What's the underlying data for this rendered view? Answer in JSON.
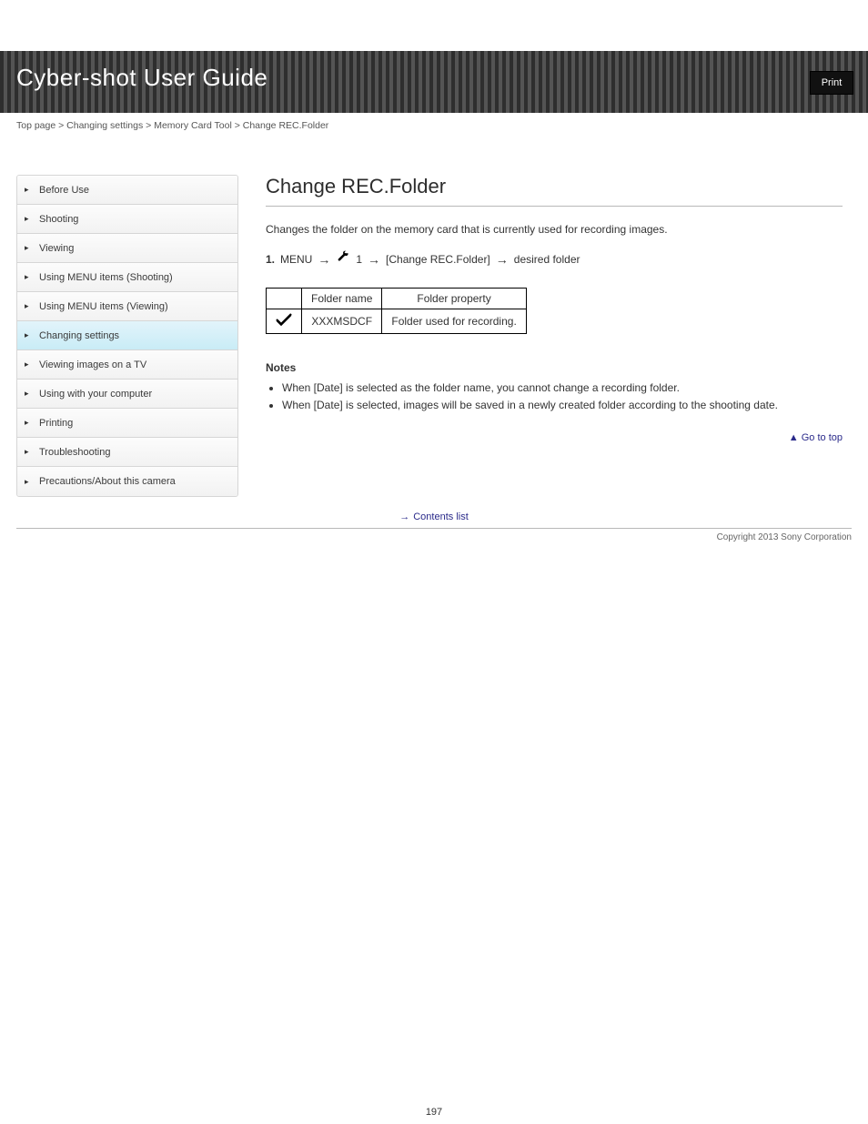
{
  "header": {
    "title": "Cyber-shot User Guide",
    "print_label": "Print"
  },
  "sidebar": {
    "items": [
      {
        "label": "Before Use"
      },
      {
        "label": "Shooting"
      },
      {
        "label": "Viewing"
      },
      {
        "label": "Using MENU items (Shooting)"
      },
      {
        "label": "Using MENU items (Viewing)"
      },
      {
        "label": "Changing settings"
      },
      {
        "label": "Viewing images on a TV"
      },
      {
        "label": "Using with your computer"
      },
      {
        "label": "Printing"
      },
      {
        "label": "Troubleshooting"
      },
      {
        "label": "Precautions/About this camera"
      }
    ]
  },
  "footer_link": {
    "label": "Contents list"
  },
  "breadcrumb": "Top page > Changing settings > Memory Card Tool > Change REC.Folder",
  "content": {
    "title": "Change REC.Folder",
    "description": "Changes the folder on the memory card that is currently used for recording images.",
    "menu_path": [
      "MENU",
      "",
      "1",
      "[Change REC.Folder]",
      "desired folder"
    ]
  },
  "table": {
    "headers": [
      "",
      "Folder name",
      "Folder property"
    ],
    "row": {
      "icon": "check",
      "name": "XXXMSDCF",
      "property": "Folder used for recording."
    }
  },
  "notes": {
    "heading": "Notes",
    "items": [
      "When [Date] is selected as the folder name, you cannot change a recording folder.",
      "When [Date] is selected, images will be saved in a newly created folder according to the shooting date."
    ]
  },
  "go_top": "Go to top",
  "copyright": "Copyright 2013 Sony Corporation",
  "page_number": "197"
}
